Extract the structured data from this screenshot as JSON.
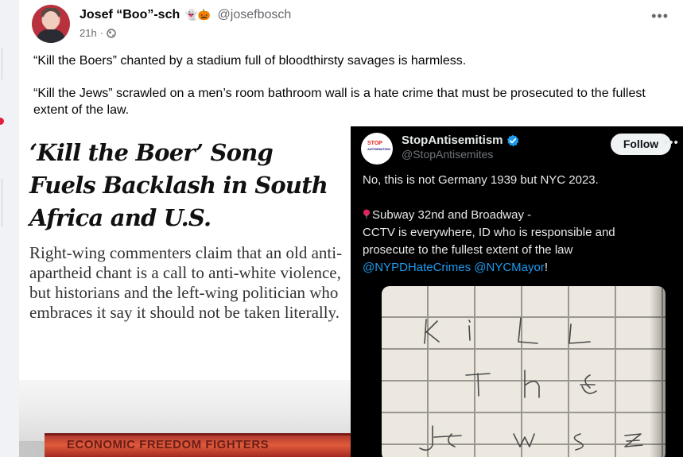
{
  "post": {
    "author": "Josef “Boo”-sch",
    "emojis": "👻🎃",
    "handle": "@josefbosch",
    "time": "21h",
    "separator": "·",
    "more": "•••",
    "paragraphs": [
      "“Kill the Boers” chanted by a stadium full of bloodthirsty savages is harmless.",
      "“Kill the Jews” scrawled on a men’s room bathroom wall is a hate crime that must be prosecuted to the fullest extent of the law."
    ]
  },
  "nyt_image": {
    "headline": "‘Kill the Boer’ Song Fuels Backlash in South Africa and U.S.",
    "subhead": "Right-wing commenters claim that an old anti-apartheid chant is a call to anti-white violence, but historians and the left-wing politician who embraces it say it should not be taken literally.",
    "banner_text": "ECONOMIC FREEDOM FIGHTERS"
  },
  "tweet_image": {
    "name": "StopAntisemitism",
    "handle": "@StopAntisemites",
    "follow_label": "Follow",
    "more": "•••",
    "logo_text_top": "STOP",
    "logo_text_bottom": "ANTISEMITISM",
    "line1": "No, this is not Germany 1939 but NYC 2023.",
    "line2": "Subway 32nd and Broadway -",
    "line3": "CCTV is everywhere, ID who is responsible and",
    "line4": "prosecute to the fullest extent of the law",
    "mention1": "@NYPDHateCrimes",
    "mention2": "@NYCMayor",
    "end_punct": "!",
    "scrawl_rows": [
      "K i L L",
      "T h e",
      "J e w s Z"
    ]
  },
  "colors": {
    "link": "#1d9bf0",
    "verified": "#1d9bf0",
    "notification_dot": "#e41e3f",
    "pin": "#e0245e"
  }
}
